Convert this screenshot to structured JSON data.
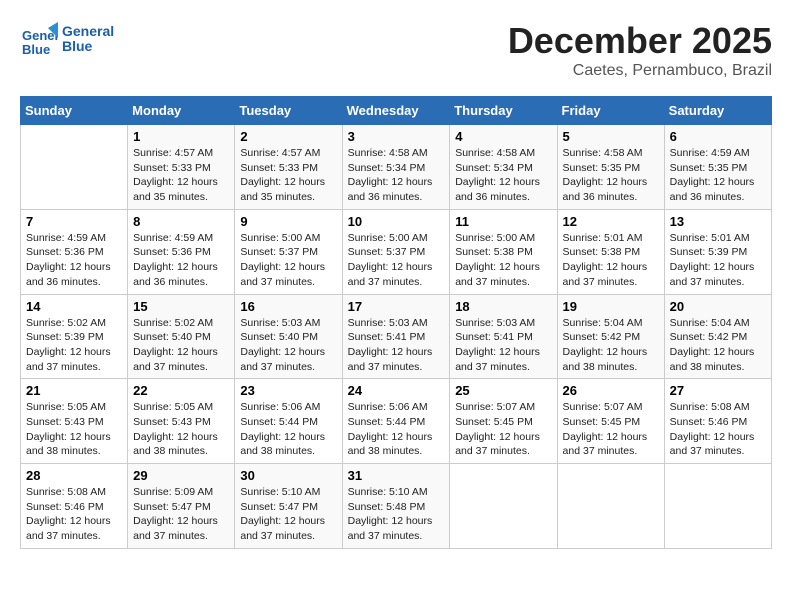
{
  "logo": {
    "text_general": "General",
    "text_blue": "Blue"
  },
  "header": {
    "month": "December 2025",
    "location": "Caetes, Pernambuco, Brazil"
  },
  "days_of_week": [
    "Sunday",
    "Monday",
    "Tuesday",
    "Wednesday",
    "Thursday",
    "Friday",
    "Saturday"
  ],
  "weeks": [
    [
      {
        "day": "",
        "info": ""
      },
      {
        "day": "1",
        "info": "Sunrise: 4:57 AM\nSunset: 5:33 PM\nDaylight: 12 hours\nand 35 minutes."
      },
      {
        "day": "2",
        "info": "Sunrise: 4:57 AM\nSunset: 5:33 PM\nDaylight: 12 hours\nand 35 minutes."
      },
      {
        "day": "3",
        "info": "Sunrise: 4:58 AM\nSunset: 5:34 PM\nDaylight: 12 hours\nand 36 minutes."
      },
      {
        "day": "4",
        "info": "Sunrise: 4:58 AM\nSunset: 5:34 PM\nDaylight: 12 hours\nand 36 minutes."
      },
      {
        "day": "5",
        "info": "Sunrise: 4:58 AM\nSunset: 5:35 PM\nDaylight: 12 hours\nand 36 minutes."
      },
      {
        "day": "6",
        "info": "Sunrise: 4:59 AM\nSunset: 5:35 PM\nDaylight: 12 hours\nand 36 minutes."
      }
    ],
    [
      {
        "day": "7",
        "info": "Sunrise: 4:59 AM\nSunset: 5:36 PM\nDaylight: 12 hours\nand 36 minutes."
      },
      {
        "day": "8",
        "info": "Sunrise: 4:59 AM\nSunset: 5:36 PM\nDaylight: 12 hours\nand 36 minutes."
      },
      {
        "day": "9",
        "info": "Sunrise: 5:00 AM\nSunset: 5:37 PM\nDaylight: 12 hours\nand 37 minutes."
      },
      {
        "day": "10",
        "info": "Sunrise: 5:00 AM\nSunset: 5:37 PM\nDaylight: 12 hours\nand 37 minutes."
      },
      {
        "day": "11",
        "info": "Sunrise: 5:00 AM\nSunset: 5:38 PM\nDaylight: 12 hours\nand 37 minutes."
      },
      {
        "day": "12",
        "info": "Sunrise: 5:01 AM\nSunset: 5:38 PM\nDaylight: 12 hours\nand 37 minutes."
      },
      {
        "day": "13",
        "info": "Sunrise: 5:01 AM\nSunset: 5:39 PM\nDaylight: 12 hours\nand 37 minutes."
      }
    ],
    [
      {
        "day": "14",
        "info": "Sunrise: 5:02 AM\nSunset: 5:39 PM\nDaylight: 12 hours\nand 37 minutes."
      },
      {
        "day": "15",
        "info": "Sunrise: 5:02 AM\nSunset: 5:40 PM\nDaylight: 12 hours\nand 37 minutes."
      },
      {
        "day": "16",
        "info": "Sunrise: 5:03 AM\nSunset: 5:40 PM\nDaylight: 12 hours\nand 37 minutes."
      },
      {
        "day": "17",
        "info": "Sunrise: 5:03 AM\nSunset: 5:41 PM\nDaylight: 12 hours\nand 37 minutes."
      },
      {
        "day": "18",
        "info": "Sunrise: 5:03 AM\nSunset: 5:41 PM\nDaylight: 12 hours\nand 37 minutes."
      },
      {
        "day": "19",
        "info": "Sunrise: 5:04 AM\nSunset: 5:42 PM\nDaylight: 12 hours\nand 38 minutes."
      },
      {
        "day": "20",
        "info": "Sunrise: 5:04 AM\nSunset: 5:42 PM\nDaylight: 12 hours\nand 38 minutes."
      }
    ],
    [
      {
        "day": "21",
        "info": "Sunrise: 5:05 AM\nSunset: 5:43 PM\nDaylight: 12 hours\nand 38 minutes."
      },
      {
        "day": "22",
        "info": "Sunrise: 5:05 AM\nSunset: 5:43 PM\nDaylight: 12 hours\nand 38 minutes."
      },
      {
        "day": "23",
        "info": "Sunrise: 5:06 AM\nSunset: 5:44 PM\nDaylight: 12 hours\nand 38 minutes."
      },
      {
        "day": "24",
        "info": "Sunrise: 5:06 AM\nSunset: 5:44 PM\nDaylight: 12 hours\nand 38 minutes."
      },
      {
        "day": "25",
        "info": "Sunrise: 5:07 AM\nSunset: 5:45 PM\nDaylight: 12 hours\nand 37 minutes."
      },
      {
        "day": "26",
        "info": "Sunrise: 5:07 AM\nSunset: 5:45 PM\nDaylight: 12 hours\nand 37 minutes."
      },
      {
        "day": "27",
        "info": "Sunrise: 5:08 AM\nSunset: 5:46 PM\nDaylight: 12 hours\nand 37 minutes."
      }
    ],
    [
      {
        "day": "28",
        "info": "Sunrise: 5:08 AM\nSunset: 5:46 PM\nDaylight: 12 hours\nand 37 minutes."
      },
      {
        "day": "29",
        "info": "Sunrise: 5:09 AM\nSunset: 5:47 PM\nDaylight: 12 hours\nand 37 minutes."
      },
      {
        "day": "30",
        "info": "Sunrise: 5:10 AM\nSunset: 5:47 PM\nDaylight: 12 hours\nand 37 minutes."
      },
      {
        "day": "31",
        "info": "Sunrise: 5:10 AM\nSunset: 5:48 PM\nDaylight: 12 hours\nand 37 minutes."
      },
      {
        "day": "",
        "info": ""
      },
      {
        "day": "",
        "info": ""
      },
      {
        "day": "",
        "info": ""
      }
    ]
  ]
}
